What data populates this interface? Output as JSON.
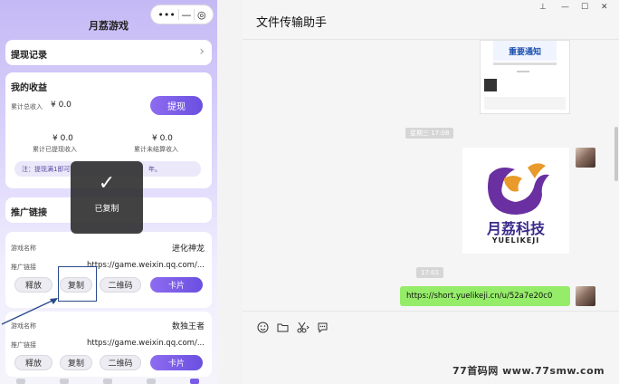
{
  "phone": {
    "title": "月荔游戏",
    "capsule": {
      "more": "•••",
      "minus": "—",
      "close": "◎"
    },
    "withdraw_record": {
      "label": "提现记录",
      "arrow": "›"
    },
    "earnings": {
      "title": "我的收益",
      "total_label": "累计总收入",
      "total_value": "¥ 0.0",
      "withdraw_button": "提现",
      "withdrawn_value": "¥ 0.0",
      "withdrawn_label": "累计已提现收入",
      "pending_value": "¥ 0.0",
      "pending_label": "累计未结算收入",
      "notice_left": "注：提现满1即可",
      "notice_right": "年。"
    },
    "promo": {
      "title": "推广链接",
      "games": [
        {
          "name_label": "游戏名称",
          "name": "进化神龙",
          "link_label": "推广链接",
          "link": "https://game.weixin.qq.com/...",
          "actions": [
            "释放",
            "复制",
            "二维码",
            "卡片"
          ]
        },
        {
          "name_label": "游戏名称",
          "name": "数独王者",
          "link_label": "推广链接",
          "link": "https://game.weixin.qq.com/...",
          "actions": [
            "释放",
            "复制",
            "二维码",
            "卡片"
          ]
        }
      ]
    },
    "toast": {
      "icon": "✓",
      "text": "已复制"
    }
  },
  "chat": {
    "title": "文件传输助手",
    "controls": {
      "pin": "⊥",
      "minimize": "—",
      "maximize": "☐",
      "close": "✕"
    },
    "timestamps": [
      "星期三 17:08",
      "17:01"
    ],
    "top_image_caption": "重要通知",
    "logo": {
      "text": "月荔科技",
      "subtext": "YUELIKEJI"
    },
    "link_message": "https://short.yuelikeji.cn/u/52a7e20c0",
    "toolbar_icons": [
      "emoji-icon",
      "folder-icon",
      "scissors-icon",
      "chat-history-icon"
    ]
  },
  "watermark": "77首码网 www.77smw.com",
  "colors": {
    "purple": "#7a5ce8",
    "bubble_green": "#95ec69",
    "logo_purple": "#6a2fa0",
    "logo_orange": "#e89a2a"
  }
}
